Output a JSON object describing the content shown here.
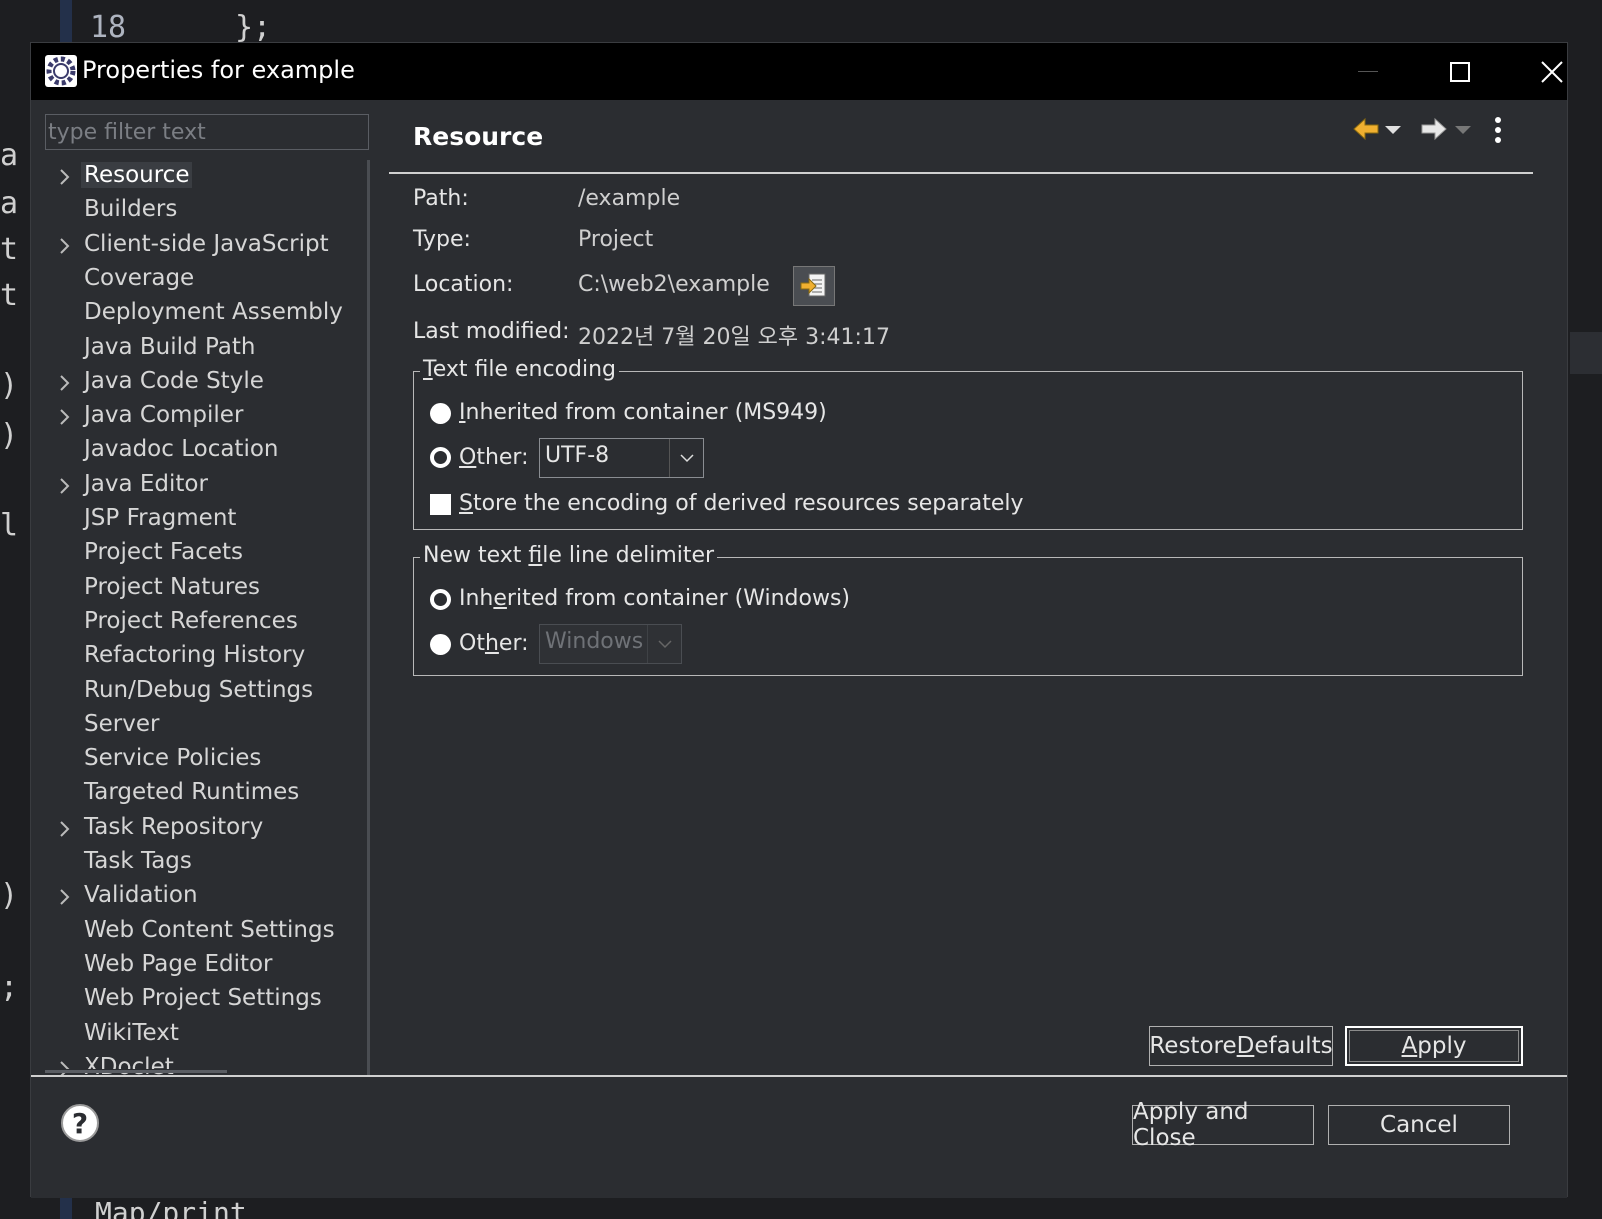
{
  "background": {
    "line_number": "18",
    "code_fragment": "};",
    "left_fragments": [
      "a",
      "a",
      "t",
      "t",
      ")",
      ")",
      "l",
      ")",
      ";"
    ],
    "bottom_fragment": "Map/print"
  },
  "dialog": {
    "title": "Properties for example",
    "filter_placeholder": "type filter text",
    "tree_items": [
      {
        "label": "Resource",
        "expandable": true,
        "selected": true
      },
      {
        "label": "Builders",
        "expandable": false
      },
      {
        "label": "Client-side JavaScript",
        "expandable": true
      },
      {
        "label": "Coverage",
        "expandable": false
      },
      {
        "label": "Deployment Assembly",
        "expandable": false
      },
      {
        "label": "Java Build Path",
        "expandable": false
      },
      {
        "label": "Java Code Style",
        "expandable": true
      },
      {
        "label": "Java Compiler",
        "expandable": true
      },
      {
        "label": "Javadoc Location",
        "expandable": false
      },
      {
        "label": "Java Editor",
        "expandable": true
      },
      {
        "label": "JSP Fragment",
        "expandable": false
      },
      {
        "label": "Project Facets",
        "expandable": false
      },
      {
        "label": "Project Natures",
        "expandable": false
      },
      {
        "label": "Project References",
        "expandable": false
      },
      {
        "label": "Refactoring History",
        "expandable": false
      },
      {
        "label": "Run/Debug Settings",
        "expandable": false
      },
      {
        "label": "Server",
        "expandable": false
      },
      {
        "label": "Service Policies",
        "expandable": false
      },
      {
        "label": "Targeted Runtimes",
        "expandable": false
      },
      {
        "label": "Task Repository",
        "expandable": true
      },
      {
        "label": "Task Tags",
        "expandable": false
      },
      {
        "label": "Validation",
        "expandable": true
      },
      {
        "label": "Web Content Settings",
        "expandable": false
      },
      {
        "label": "Web Page Editor",
        "expandable": false
      },
      {
        "label": "Web Project Settings",
        "expandable": false
      },
      {
        "label": "WikiText",
        "expandable": false
      },
      {
        "label": "XDoclet",
        "expandable": true
      }
    ],
    "page": {
      "title": "Resource",
      "path_label": "Path:",
      "path_value": "/example",
      "type_label": "Type:",
      "type_value": "Project",
      "location_label": "Location:",
      "location_value": "C:\\web2\\example",
      "modified_label": "Last modified:",
      "modified_value": "2022년 7월 20일 오후 3:41:17",
      "encoding_group": {
        "title_pre": "",
        "title_key": "T",
        "title_post": "ext file encoding",
        "inherited_key": "I",
        "inherited_post": "nherited from container (MS949)",
        "other_key": "O",
        "other_post": "ther:",
        "other_value": "UTF-8",
        "store_key": "S",
        "store_post": "tore the encoding of derived resources separately"
      },
      "delimiter_group": {
        "title_pre": "New text ",
        "title_key": "f",
        "title_post": "ile line delimiter",
        "inherited_pre": "Inh",
        "inherited_key": "e",
        "inherited_post": "rited from container (Windows)",
        "other_pre": "Ot",
        "other_key": "h",
        "other_post": "er:",
        "other_value": "Windows"
      },
      "restore_pre": "Restore ",
      "restore_key": "D",
      "restore_post": "efaults",
      "apply_key": "A",
      "apply_post": "pply"
    },
    "footer": {
      "help_glyph": "?",
      "apply_close": "Apply and Close",
      "cancel": "Cancel"
    }
  },
  "colors": {
    "dialog_bg": "#2b2d31",
    "titlebar_bg": "#000000",
    "text": "#e6e6e6"
  }
}
